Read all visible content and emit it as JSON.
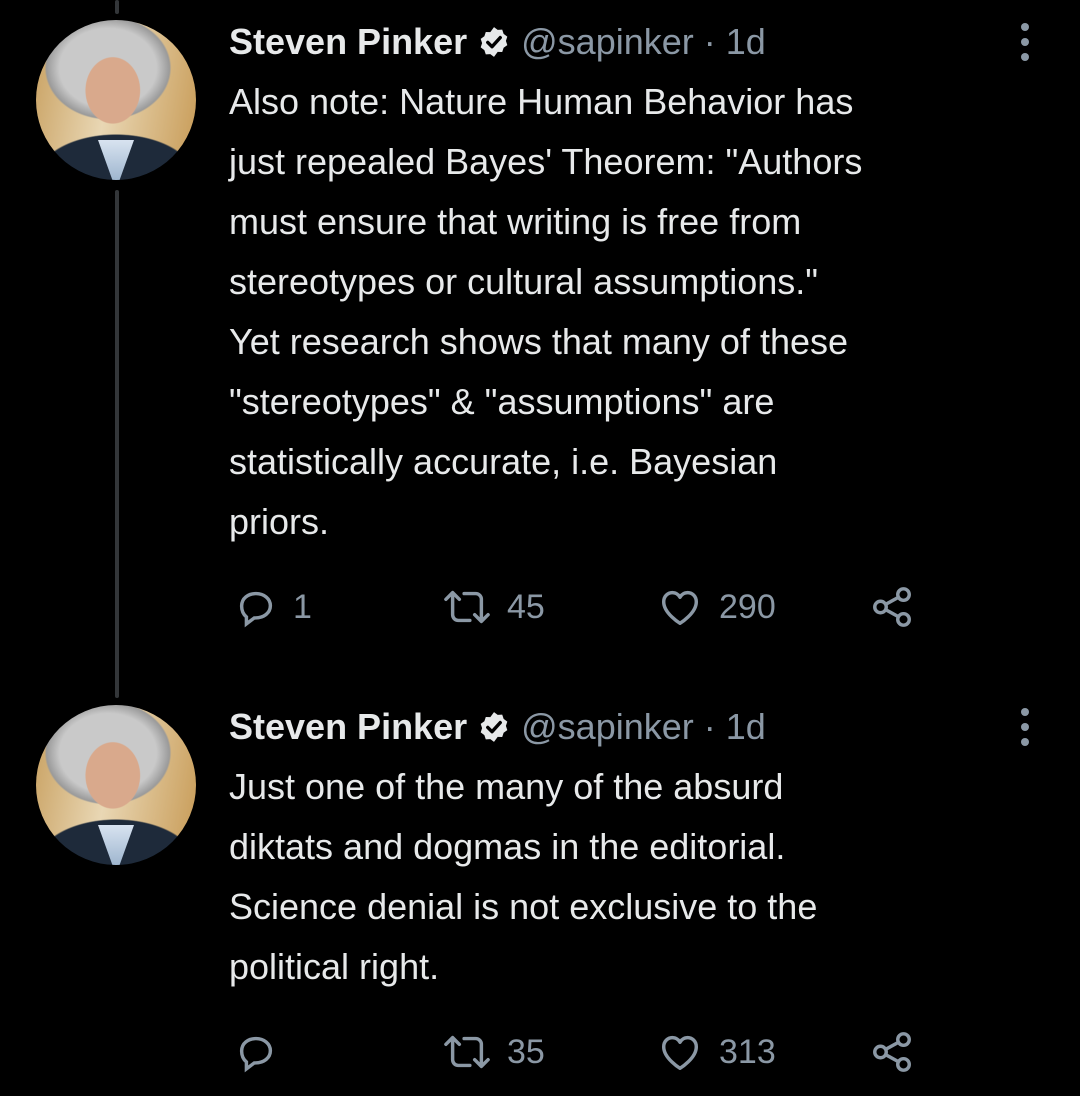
{
  "tweets": [
    {
      "author_name": "Steven Pinker",
      "handle_time": "@sapinker · 1d",
      "text": "Also note: Nature Human Behavior has\njust repealed Bayes' Theorem: \"Authors\nmust ensure that writing is free from\nstereotypes or cultural assumptions.\"\nYet research shows that many of these\n\"stereotypes\" & \"assumptions\" are\nstatistically accurate, i.e. Bayesian\npriors.",
      "replies": "1",
      "retweets": "45",
      "likes": "290"
    },
    {
      "author_name": "Steven Pinker",
      "handle_time": "@sapinker · 1d",
      "text": "Just one of the many of the absurd\ndiktats and dogmas in the editorial.\nScience denial is not exclusive to the\npolitical right.",
      "replies": "",
      "retweets": "35",
      "likes": "313"
    }
  ],
  "icons": {
    "verified": "verified-badge-icon",
    "reply": "reply-icon",
    "retweet": "retweet-icon",
    "like": "heart-icon",
    "share": "share-icon",
    "more": "more-options-icon"
  },
  "colors": {
    "background": "#000000",
    "text": "#e7e9ea",
    "secondary": "#8b98a5",
    "thread_line": "#333639"
  }
}
